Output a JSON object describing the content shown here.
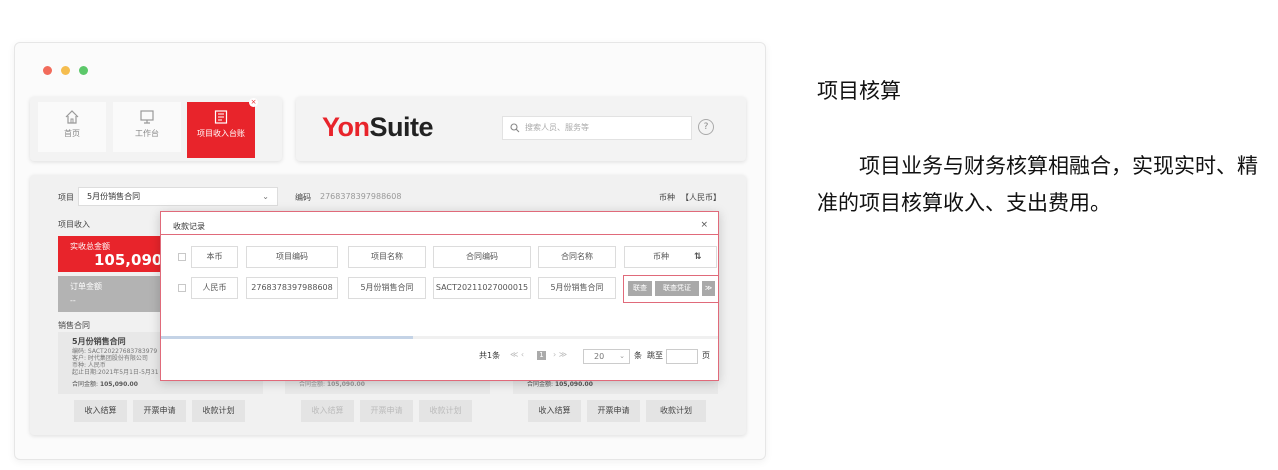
{
  "window": {
    "dot_colors": [
      "#f26b5b",
      "#f5bd4f",
      "#5cc86a"
    ]
  },
  "tabs": [
    {
      "label": "首页",
      "icon": "home-icon"
    },
    {
      "label": "工作台",
      "icon": "monitor-icon"
    },
    {
      "label": "项目收入台账",
      "icon": "ledger-icon",
      "active": true
    }
  ],
  "header": {
    "logo_part1": "Yon",
    "logo_part2": "Suite",
    "search_placeholder": "搜索人员、服务等",
    "help": "?"
  },
  "main": {
    "project_label": "项目",
    "project_value": "5月份销售合同",
    "code_label": "编码",
    "code_value": "2768378397988608",
    "currency_label": "币种",
    "currency_value": "【人民币】",
    "income_section": "项目收入",
    "actual_total_label": "实收总金额",
    "actual_total_value": "105,090.00",
    "order_amount_label": "订单金额",
    "order_amount_value": "--",
    "sales_contract_section": "销售合同",
    "contract": {
      "title": "5月份销售合同",
      "code": "编码: SACT20227683783979",
      "customer": "客户: 时代集团股份有限公司",
      "currency": "币种: 人民币",
      "period": "起止日期:2021年5月1日-5月31",
      "amount_label": "合同金额:",
      "amount_value": "105,090.00"
    },
    "contract_amount_line_label": "合同金额:",
    "contract_amount_line_value": "105,090.00",
    "buttons": [
      "收入结算",
      "开票申请",
      "收款计划"
    ]
  },
  "modal": {
    "title": "收款记录",
    "close": "×",
    "headers": [
      "本币",
      "项目编码",
      "项目名称",
      "合同编码",
      "合同名称",
      "币种"
    ],
    "row": [
      "人民币",
      "2768378397988608",
      "5月份销售合同",
      "SACT20211027000015",
      "5月份销售合同"
    ],
    "actions": [
      "联查",
      "联查凭证",
      "≫"
    ],
    "pager": {
      "total": "共1条",
      "prev": "≪ ‹",
      "page": "1",
      "next": "› ≫",
      "page_size": "20",
      "per": "条",
      "jump": "跳至",
      "page_unit": "页"
    }
  },
  "right": {
    "title": "项目核算",
    "body": "项目业务与财务核算相融合，实现实时、精准的项目核算收入、支出费用。"
  },
  "colors": {
    "accent": "#e8242b",
    "modal_border": "#e06a7a"
  }
}
